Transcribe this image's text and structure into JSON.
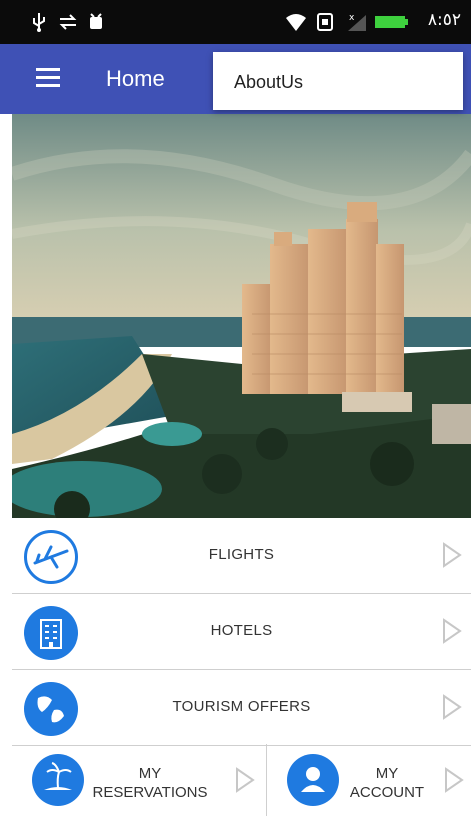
{
  "status_bar": {
    "time": "٨:٥٢"
  },
  "app_bar": {
    "title": "Home",
    "menu_icon": "hamburger-icon"
  },
  "popup_menu": {
    "items": [
      "AboutUs"
    ]
  },
  "hero": {
    "description_icon": "resort-photo"
  },
  "list": [
    {
      "label": "FLIGHTS",
      "icon": "airplane-icon"
    },
    {
      "label": "HOTELS",
      "icon": "hotel-icon"
    },
    {
      "label": "TOURISM OFFERS",
      "icon": "globe-icon"
    }
  ],
  "bottom": {
    "left": {
      "line1": "MY",
      "line2": "RESERVATIONS",
      "icon": "island-icon"
    },
    "right": {
      "line1": "MY",
      "line2": "ACCOUNT",
      "icon": "user-icon"
    }
  },
  "colors": {
    "primary": "#3f51b5",
    "icon_blue": "#1f7ae0",
    "chevron": "#c7c7c7"
  }
}
